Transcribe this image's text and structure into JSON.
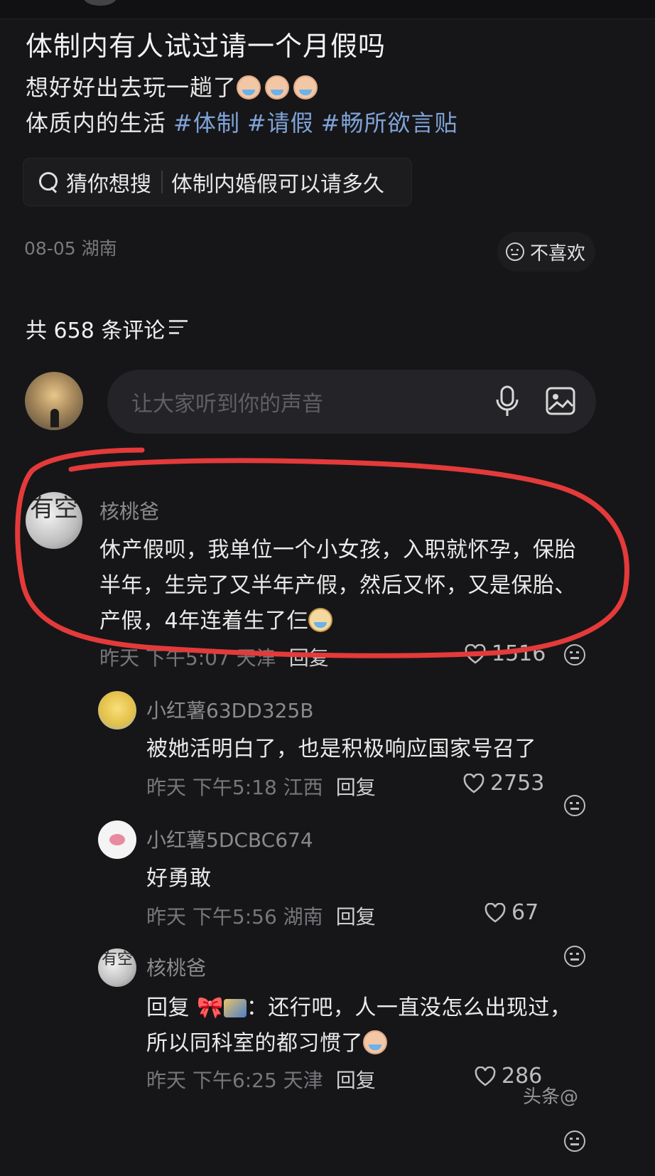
{
  "post": {
    "title": "体制内有人试过请一个月假吗",
    "line1": "想好好出去玩一趟了",
    "line2_prefix": "体质内的生活",
    "tags": [
      "#体制",
      "#请假",
      "#畅所欲言贴"
    ],
    "suggest_label": "猜你想搜",
    "suggest_query": "体制内婚假可以请多久",
    "meta": "08-05 湖南",
    "dislike_label": "不喜欢"
  },
  "comments_header": {
    "count_label": "共 658 条评论"
  },
  "input": {
    "placeholder": "让大家听到你的声音"
  },
  "comments": [
    {
      "avatar_text": "有空",
      "user": "核桃爸",
      "lines": [
        "休产假呗，我单位一个小女孩，入职就怀孕，保胎",
        "半年，生完了又半年产假，然后又怀，又是保胎、",
        "产假，4年连着生了仨"
      ],
      "meta": "昨天 下午5:07 天津",
      "reply": "回复",
      "likes": "1516"
    },
    {
      "user": "小红薯63DD325B",
      "lines": [
        "被她活明白了，也是积极响应国家号召了"
      ],
      "meta": "昨天 下午5:18 江西",
      "reply": "回复",
      "likes": "2753"
    },
    {
      "user": "小红薯5DCBC674",
      "lines": [
        "好勇敢"
      ],
      "meta": "昨天 下午5:56 湖南",
      "reply": "回复",
      "likes": "67"
    },
    {
      "avatar_text": "有空",
      "user": "核桃爸",
      "reply_prefix": "回复",
      "reply_suffix": "：还行吧，人一直没怎么出现过，",
      "line2": "所以同科室的都习惯了",
      "meta": "昨天 下午6:25 天津",
      "reply": "回复",
      "likes": "286"
    }
  ],
  "watermark": "头条@"
}
